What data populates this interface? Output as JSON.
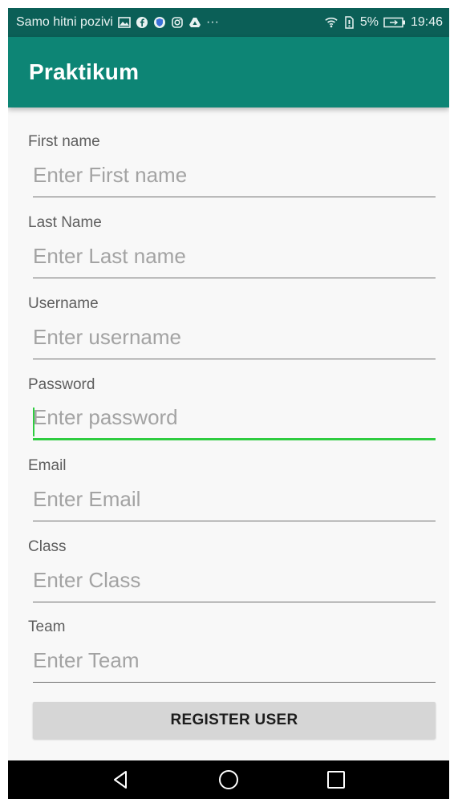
{
  "status_bar": {
    "carrier": "Samo hitni pozivi",
    "overflow": "···",
    "battery_percent": "5%",
    "time": "19:46",
    "left_icons": [
      "mail-icon",
      "facebook-icon",
      "vpn-icon",
      "instagram-icon",
      "drive-icon"
    ],
    "right_icons": [
      "wifi-icon",
      "sim-icon",
      "battery-icon"
    ]
  },
  "toolbar": {
    "title": "Praktikum"
  },
  "form": {
    "fields": [
      {
        "label": "First name",
        "placeholder": "Enter First name",
        "focused": false
      },
      {
        "label": "Last Name",
        "placeholder": "Enter Last name",
        "focused": false
      },
      {
        "label": "Username",
        "placeholder": "Enter username",
        "focused": false
      },
      {
        "label": "Password",
        "placeholder": "Enter password",
        "focused": true
      },
      {
        "label": "Email",
        "placeholder": "Enter Email",
        "focused": false
      },
      {
        "label": "Class",
        "placeholder": "Enter Class",
        "focused": false
      },
      {
        "label": "Team",
        "placeholder": "Enter Team",
        "focused": false
      }
    ],
    "submit_label": "REGISTER USER"
  },
  "colors": {
    "status_bar": "#0b5f57",
    "toolbar": "#0d8575",
    "focus_accent": "#2ecc40",
    "button": "#d6d6d6"
  },
  "nav_bar": {
    "icons": [
      "back-icon",
      "home-icon",
      "recents-icon"
    ]
  }
}
